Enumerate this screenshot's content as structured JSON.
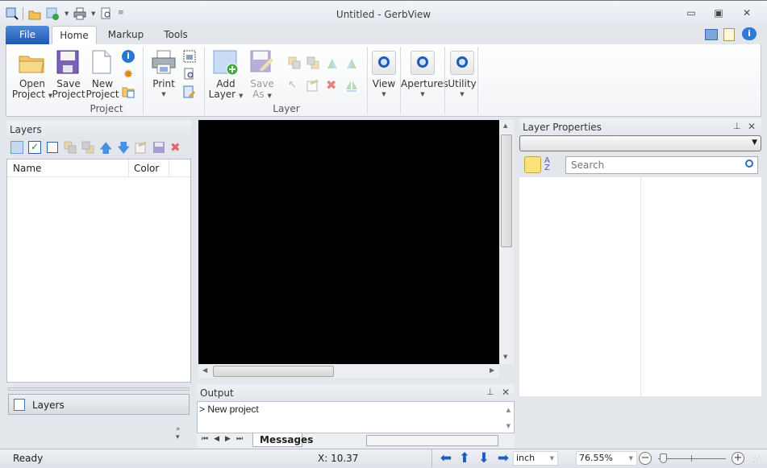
{
  "window": {
    "title": "Untitled - GerbView"
  },
  "quick_access": {
    "icons": [
      "zoom-icon",
      "open-folder-icon",
      "add-layer-icon",
      "print-icon",
      "print-preview-icon",
      "customize-qat-icon"
    ]
  },
  "tabs": [
    {
      "label": "File",
      "active": false
    },
    {
      "label": "Home",
      "active": true
    },
    {
      "label": "Markup",
      "active": false
    },
    {
      "label": "Tools",
      "active": false
    }
  ],
  "ribbon": {
    "groups": {
      "project": "Project",
      "layer": "Layer"
    },
    "open_project": {
      "line1": "Open",
      "line2": "Project"
    },
    "save_project": {
      "line1": "Save",
      "line2": "Project"
    },
    "new_project": {
      "line1": "New",
      "line2": "Project"
    },
    "print": {
      "line1": "Print"
    },
    "add_layer": {
      "line1": "Add",
      "line2": "Layer"
    },
    "save_as": {
      "line1": "Save",
      "line2": "As"
    },
    "view": "View",
    "apertures": "Apertures",
    "utility": "Utility"
  },
  "layers_panel": {
    "title": "Layers",
    "columns": [
      "Name",
      "Color"
    ],
    "rows": [],
    "nav_button": "Layers"
  },
  "output_panel": {
    "title": "Output",
    "lines": [
      "> New project"
    ],
    "tab": "Messages"
  },
  "properties_panel": {
    "title": "Layer Properties",
    "selected": "",
    "search_placeholder": "Search"
  },
  "status": {
    "state": "Ready",
    "coord": "X: 10.37",
    "unit": "inch",
    "zoom": "76.55%"
  },
  "colors": {
    "accent": "#1f58b6",
    "canvas": "#000000"
  }
}
